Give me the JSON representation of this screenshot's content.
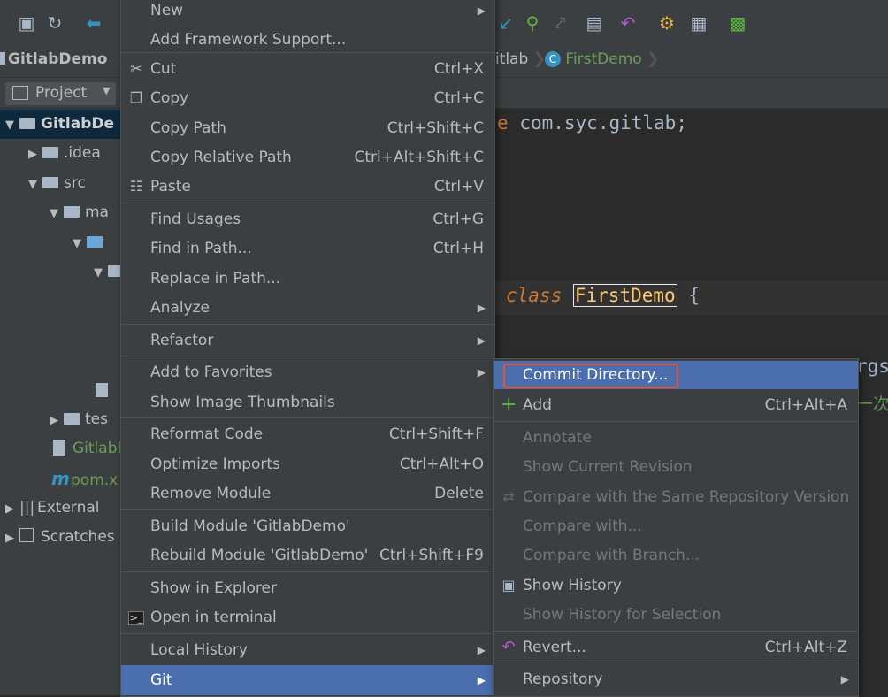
{
  "breadcrumb": {
    "project": "GitlabDemo",
    "package_tail": "itlab",
    "file": "FirstDemo"
  },
  "project_panel": {
    "view_label": "Project",
    "rows": [
      {
        "label": "GitlabDe",
        "indent": 0
      },
      {
        "label": ".idea",
        "indent": 1
      },
      {
        "label": "src",
        "indent": 1
      },
      {
        "label": "ma",
        "indent": 2
      },
      {
        "label": "",
        "indent": 3
      },
      {
        "label": "",
        "indent": 4
      },
      {
        "label": "tes",
        "indent": 2
      },
      {
        "label": "Gitlabl",
        "indent": 2
      },
      {
        "label": "pom.x",
        "indent": 2
      },
      {
        "label": "External",
        "indent": 0
      },
      {
        "label": "Scratches",
        "indent": 0
      }
    ]
  },
  "editor": {
    "package_line_kw": "e",
    "package_line": "com.syc.gitlab;",
    "class_kw": "class",
    "class_name": "FirstDemo",
    "brace": "{",
    "right_fragment1": "rgs",
    "right_fragment2": "一次"
  },
  "context_menu": {
    "items": [
      {
        "label": "New",
        "shortcut": "",
        "submenu": true
      },
      {
        "label": "Add Framework Support...",
        "shortcut": ""
      },
      {
        "label": "Cut",
        "shortcut": "Ctrl+X",
        "icon": "cut-icon"
      },
      {
        "label": "Copy",
        "shortcut": "Ctrl+C",
        "icon": "copy-icon"
      },
      {
        "label": "Copy Path",
        "shortcut": "Ctrl+Shift+C"
      },
      {
        "label": "Copy Relative Path",
        "shortcut": "Ctrl+Alt+Shift+C"
      },
      {
        "label": "Paste",
        "shortcut": "Ctrl+V",
        "icon": "paste-icon"
      },
      {
        "label": "Find Usages",
        "shortcut": "Ctrl+G"
      },
      {
        "label": "Find in Path...",
        "shortcut": "Ctrl+H"
      },
      {
        "label": "Replace in Path...",
        "shortcut": ""
      },
      {
        "label": "Analyze",
        "shortcut": "",
        "submenu": true
      },
      {
        "label": "Refactor",
        "shortcut": "",
        "submenu": true
      },
      {
        "label": "Add to Favorites",
        "shortcut": "",
        "submenu": true
      },
      {
        "label": "Show Image Thumbnails",
        "shortcut": ""
      },
      {
        "label": "Reformat Code",
        "shortcut": "Ctrl+Shift+F"
      },
      {
        "label": "Optimize Imports",
        "shortcut": "Ctrl+Alt+O"
      },
      {
        "label": "Remove Module",
        "shortcut": "Delete"
      },
      {
        "label": "Build Module 'GitlabDemo'",
        "shortcut": ""
      },
      {
        "label": "Rebuild Module 'GitlabDemo'",
        "shortcut": "Ctrl+Shift+F9"
      },
      {
        "label": "Show in Explorer",
        "shortcut": ""
      },
      {
        "label": "Open in terminal",
        "shortcut": "",
        "icon": "terminal-icon"
      },
      {
        "label": "Local History",
        "shortcut": "",
        "submenu": true
      },
      {
        "label": "Git",
        "shortcut": "",
        "submenu": true,
        "selected": true
      }
    ]
  },
  "git_submenu": {
    "items": [
      {
        "label": "Commit Directory...",
        "shortcut": "",
        "selected": true
      },
      {
        "label": "Add",
        "shortcut": "Ctrl+Alt+A",
        "icon": "plus-icon"
      },
      {
        "label": "Annotate",
        "shortcut": "",
        "disabled": true
      },
      {
        "label": "Show Current Revision",
        "shortcut": "",
        "disabled": true
      },
      {
        "label": "Compare with the Same Repository Version",
        "shortcut": "",
        "disabled": true,
        "icon": "compare-icon"
      },
      {
        "label": "Compare with...",
        "shortcut": "",
        "disabled": true
      },
      {
        "label": "Compare with Branch...",
        "shortcut": "",
        "disabled": true
      },
      {
        "label": "Show History",
        "shortcut": "",
        "icon": "history-icon"
      },
      {
        "label": "Show History for Selection",
        "shortcut": "",
        "disabled": true
      },
      {
        "label": "Revert...",
        "shortcut": "Ctrl+Alt+Z",
        "icon": "revert-icon"
      },
      {
        "label": "Repository",
        "shortcut": "",
        "submenu": true
      }
    ]
  },
  "colors": {
    "selection": "#4b6eaf",
    "commit_outline": "#e0533c",
    "keyword": "#cc7832",
    "class_name": "#ffc66d"
  }
}
